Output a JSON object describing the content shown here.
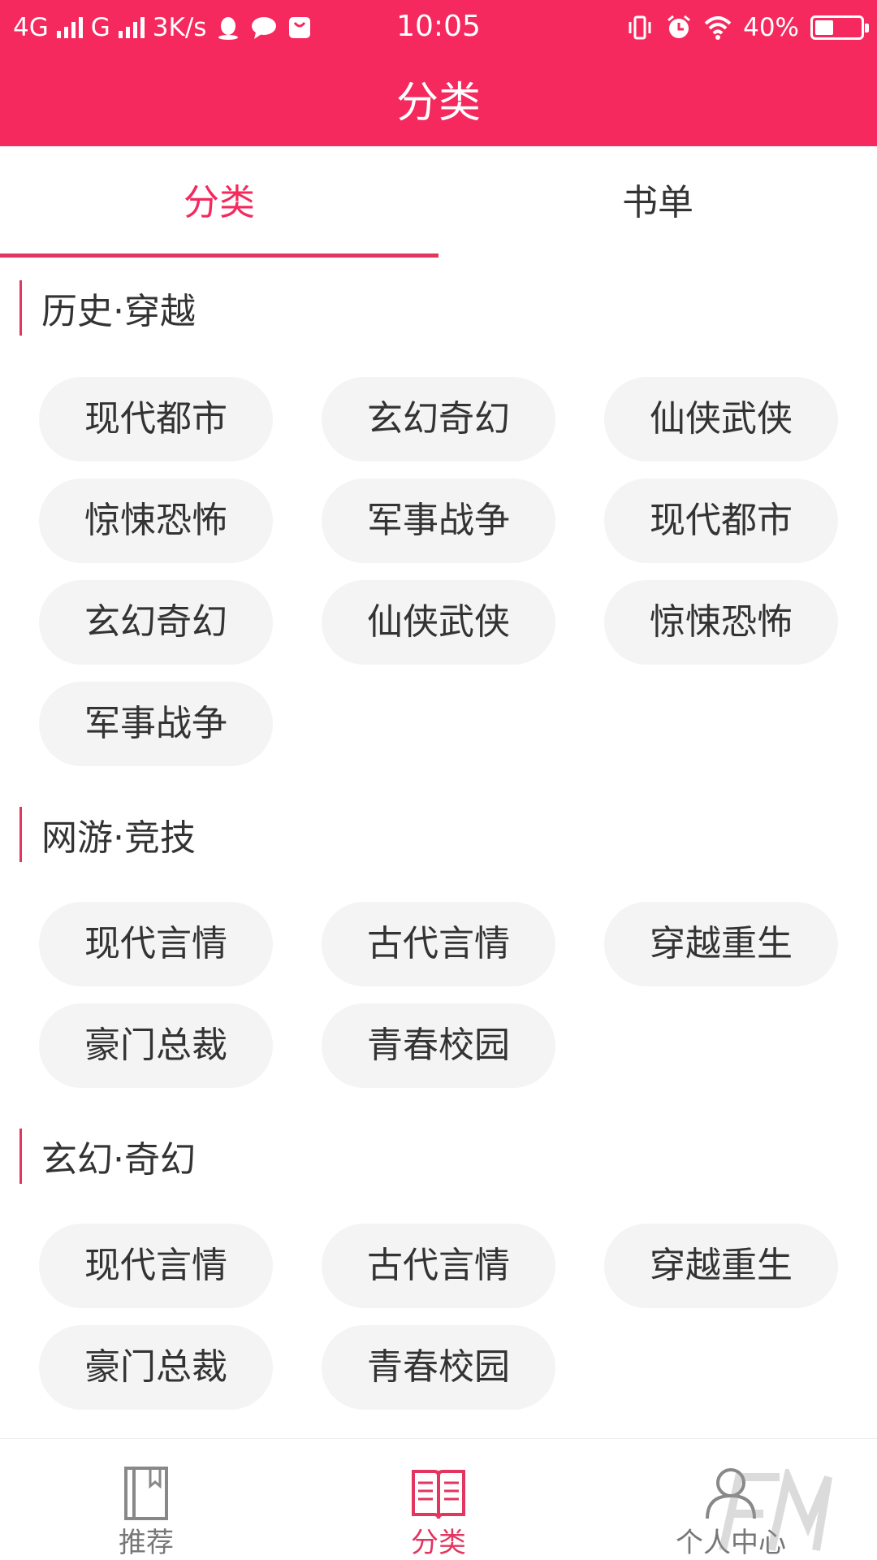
{
  "status_bar": {
    "network_1": "4G",
    "network_2": "G",
    "speed": "3K/s",
    "time": "10:05",
    "battery_percent": "40%",
    "battery_level": 0.4
  },
  "header": {
    "title": "分类"
  },
  "tabs": [
    {
      "label": "分类",
      "active": true
    },
    {
      "label": "书单",
      "active": false
    }
  ],
  "sections": [
    {
      "title": "历史·穿越",
      "chips": [
        "现代都市",
        "玄幻奇幻",
        "仙侠武侠",
        "惊悚恐怖",
        "军事战争",
        "现代都市",
        "玄幻奇幻",
        "仙侠武侠",
        "惊悚恐怖",
        "军事战争"
      ]
    },
    {
      "title": "网游·竞技",
      "chips": [
        "现代言情",
        "古代言情",
        "穿越重生",
        "豪门总裁",
        "青春校园"
      ]
    },
    {
      "title": "玄幻·奇幻",
      "chips": [
        "现代言情",
        "古代言情",
        "穿越重生",
        "豪门总裁",
        "青春校园"
      ]
    }
  ],
  "bottom_nav": [
    {
      "label": "推荐",
      "icon": "bookmark-book-icon",
      "active": false
    },
    {
      "label": "分类",
      "icon": "open-book-icon",
      "active": true
    },
    {
      "label": "个人中心",
      "icon": "person-icon",
      "active": false
    }
  ],
  "colors": {
    "accent": "#f5295d",
    "underline": "#e23560",
    "chip_bg": "#f4f4f4",
    "text": "#333333"
  }
}
